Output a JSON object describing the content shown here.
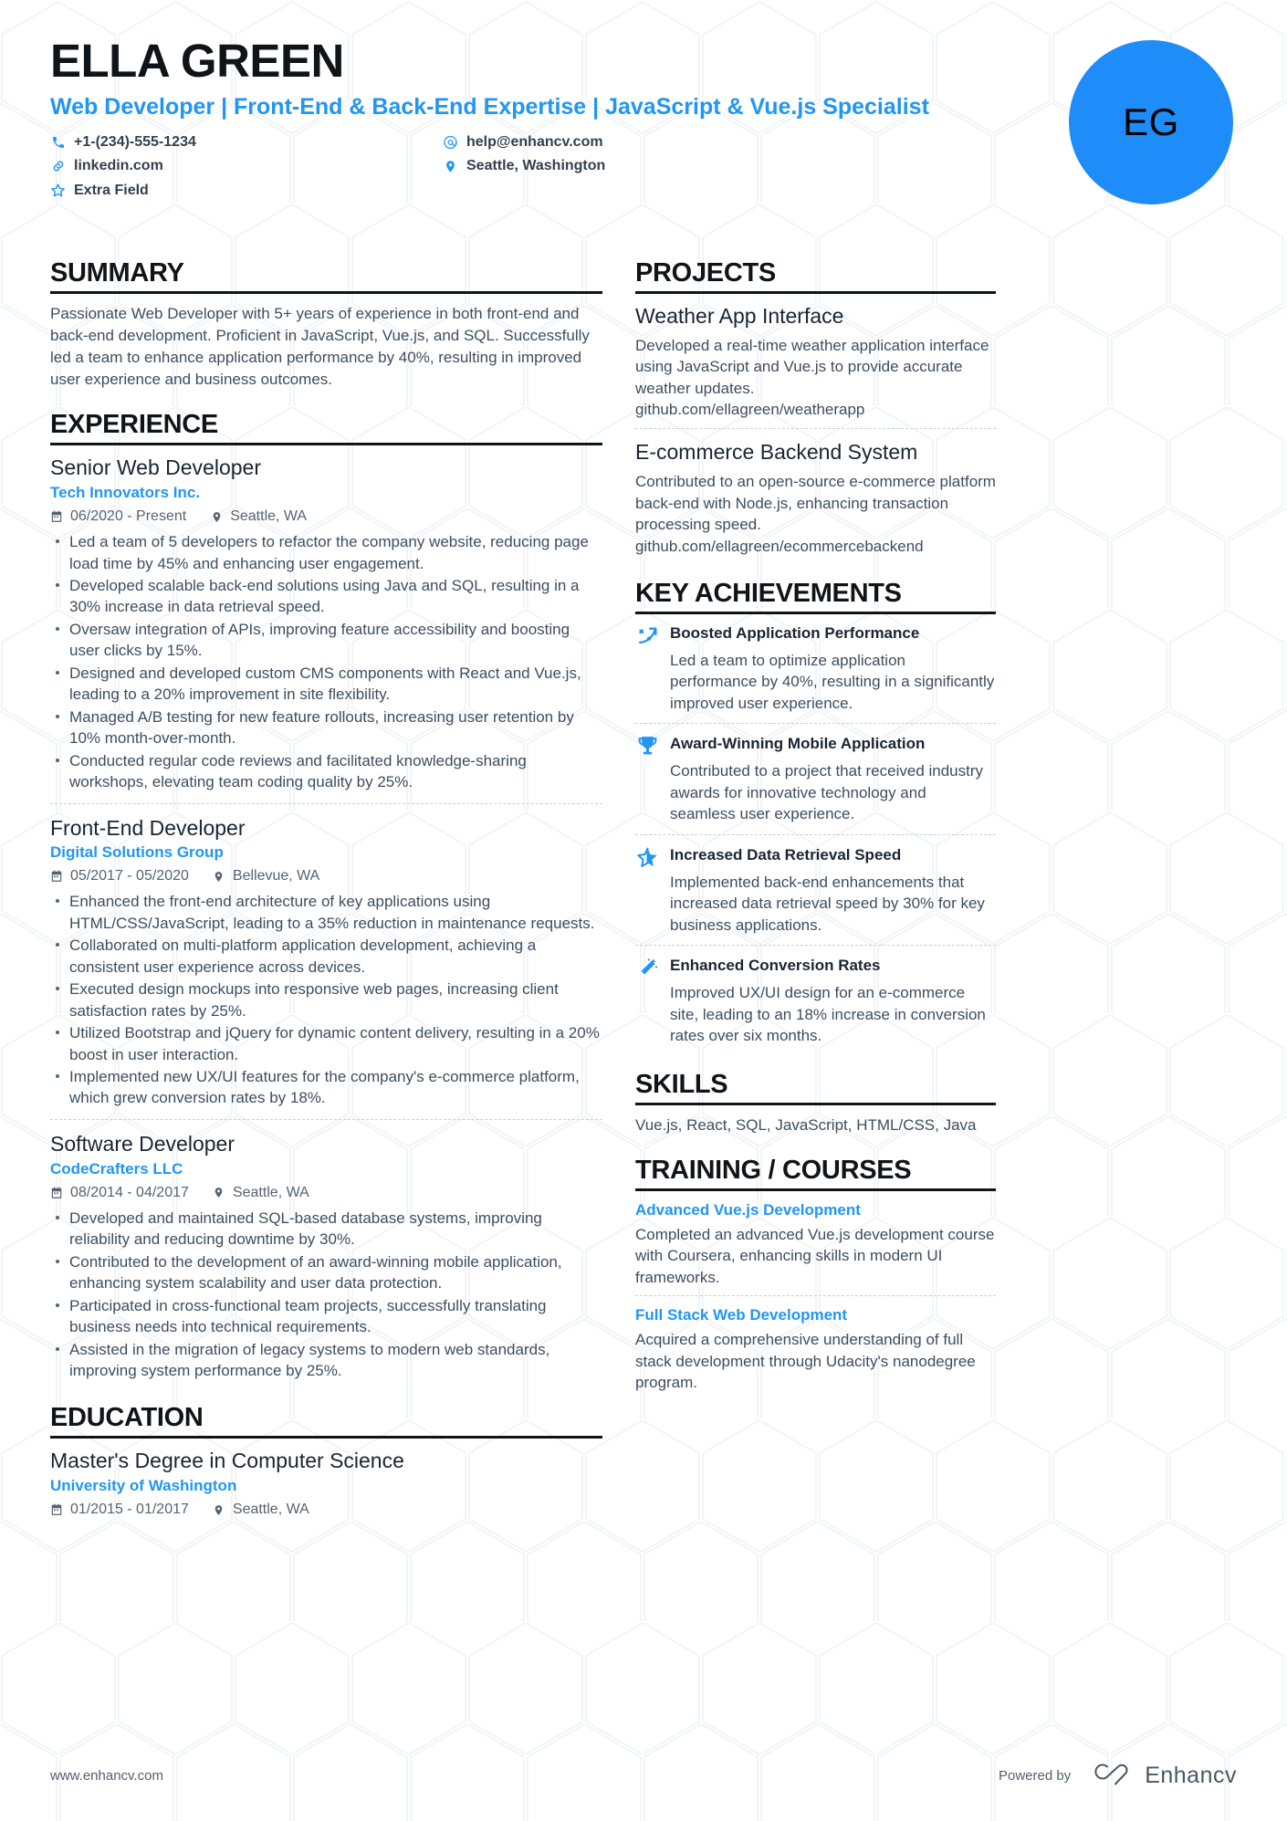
{
  "theme": {
    "accent": "#2196f3",
    "avatar_bg": "#1f8df9",
    "heading": "#0f1419",
    "body_text": "#3d4e5e"
  },
  "header": {
    "name": "ELLA GREEN",
    "headline": "Web Developer | Front-End & Back-End Expertise | JavaScript & Vue.js Specialist",
    "avatar_initials": "EG",
    "contacts_left": [
      {
        "icon": "phone-icon",
        "text": "+1-(234)-555-1234"
      },
      {
        "icon": "link-icon",
        "text": "linkedin.com"
      },
      {
        "icon": "star-icon",
        "text": "Extra Field"
      }
    ],
    "contacts_right": [
      {
        "icon": "email-icon",
        "text": "help@enhancv.com"
      },
      {
        "icon": "location-icon",
        "text": "Seattle, Washington"
      }
    ]
  },
  "summary": {
    "title": "SUMMARY",
    "text": "Passionate Web Developer with 5+ years of experience in both front-end and back-end development. Proficient in JavaScript, Vue.js, and SQL. Successfully led a team to enhance application performance by 40%, resulting in improved user experience and business outcomes."
  },
  "experience": {
    "title": "EXPERIENCE",
    "entries": [
      {
        "role": "Senior Web Developer",
        "company": "Tech Innovators Inc.",
        "dates": "06/2020 - Present",
        "location": "Seattle, WA",
        "bullets": [
          "Led a team of 5 developers to refactor the company website, reducing page load time by 45% and enhancing user engagement.",
          "Developed scalable back-end solutions using Java and SQL, resulting in a 30% increase in data retrieval speed.",
          "Oversaw integration of APIs, improving feature accessibility and boosting user clicks by 15%.",
          "Designed and developed custom CMS components with React and Vue.js, leading to a 20% improvement in site flexibility.",
          "Managed A/B testing for new feature rollouts, increasing user retention by 10% month-over-month.",
          "Conducted regular code reviews and facilitated knowledge-sharing workshops, elevating team coding quality by 25%."
        ]
      },
      {
        "role": "Front-End Developer",
        "company": "Digital Solutions Group",
        "dates": "05/2017 - 05/2020",
        "location": "Bellevue, WA",
        "bullets": [
          "Enhanced the front-end architecture of key applications using HTML/CSS/JavaScript, leading to a 35% reduction in maintenance requests.",
          "Collaborated on multi-platform application development, achieving a consistent user experience across devices.",
          "Executed design mockups into responsive web pages, increasing client satisfaction rates by 25%.",
          "Utilized Bootstrap and jQuery for dynamic content delivery, resulting in a 20% boost in user interaction.",
          "Implemented new UX/UI features for the company's e-commerce platform, which grew conversion rates by 18%."
        ]
      },
      {
        "role": "Software Developer",
        "company": "CodeCrafters LLC",
        "dates": "08/2014 - 04/2017",
        "location": "Seattle, WA",
        "bullets": [
          "Developed and maintained SQL-based database systems, improving reliability and reducing downtime by 30%.",
          "Contributed to the development of an award-winning mobile application, enhancing system scalability and user data protection.",
          "Participated in cross-functional team projects, successfully translating business needs into technical requirements.",
          "Assisted in the migration of legacy systems to modern web standards, improving system performance by 25%."
        ]
      }
    ]
  },
  "education": {
    "title": "EDUCATION",
    "entries": [
      {
        "degree": "Master's Degree in Computer Science",
        "school": "University of Washington",
        "dates": "01/2015 - 01/2017",
        "location": "Seattle, WA"
      }
    ]
  },
  "projects": {
    "title": "PROJECTS",
    "items": [
      {
        "name": "Weather App Interface",
        "description": "Developed a real-time weather application interface using JavaScript and Vue.js to provide accurate weather updates.",
        "link": "github.com/ellagreen/weatherapp"
      },
      {
        "name": "E-commerce Backend System",
        "description": "Contributed to an open-source e-commerce platform back-end with Node.js, enhancing transaction processing speed.",
        "link": "github.com/ellagreen/ecommercebackend"
      }
    ]
  },
  "achievements": {
    "title": "KEY ACHIEVEMENTS",
    "items": [
      {
        "icon": "growth-arrow-icon",
        "title": "Boosted Application Performance",
        "description": "Led a team to optimize application performance by 40%, resulting in a significantly improved user experience."
      },
      {
        "icon": "trophy-icon",
        "title": "Award-Winning Mobile Application",
        "description": "Contributed to a project that received industry awards for innovative technology and seamless user experience."
      },
      {
        "icon": "star-half-icon",
        "title": "Increased Data Retrieval Speed",
        "description": "Implemented back-end enhancements that increased data retrieval speed by 30% for key business applications."
      },
      {
        "icon": "magic-wand-icon",
        "title": "Enhanced Conversion Rates",
        "description": "Improved UX/UI design for an e-commerce site, leading to an 18% increase in conversion rates over six months."
      }
    ]
  },
  "skills": {
    "title": "SKILLS",
    "text": "Vue.js, React, SQL, JavaScript, HTML/CSS, Java"
  },
  "training": {
    "title": "TRAINING / COURSES",
    "items": [
      {
        "name": "Advanced Vue.js Development",
        "description": "Completed an advanced Vue.js development course with Coursera, enhancing skills in modern UI frameworks."
      },
      {
        "name": "Full Stack Web Development",
        "description": "Acquired a comprehensive understanding of full stack development through Udacity's nanodegree program."
      }
    ]
  },
  "footer": {
    "website": "www.enhancv.com",
    "powered_by": "Powered by",
    "brand": "Enhancv"
  }
}
